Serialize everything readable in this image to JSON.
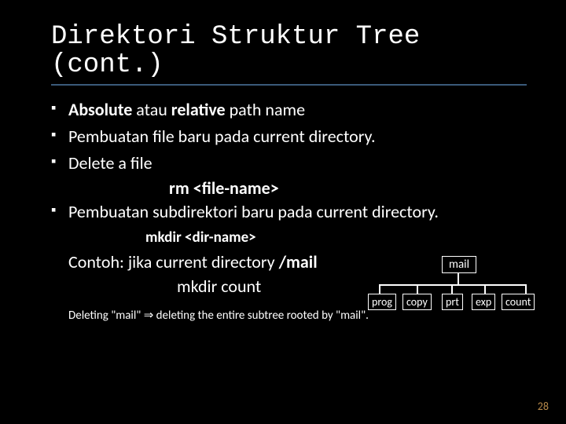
{
  "title": "Direktori Struktur Tree (cont.)",
  "bullets": {
    "b1_pre": "Absolute",
    "b1_mid": " atau ",
    "b1_bold2": "relative",
    "b1_post": " path name",
    "b2": "Pembuatan file baru pada current directory.",
    "b3": "Delete a file",
    "b3_cmd": "rm <file-name>",
    "b4": "Pembuatan subdirektori baru pada current directory.",
    "b4_cmd": "mkdir <dir-name>"
  },
  "example": {
    "line1_pre": "Contoh:  jika current directory   ",
    "line1_bold": "/mail",
    "line2": "mkdir count"
  },
  "tree": {
    "root": "mail",
    "children": [
      "prog",
      "copy",
      "prt",
      "exp",
      "count"
    ]
  },
  "footnote": {
    "pre": "Deleting \"mail\" ",
    "arrow": "⇒",
    "post": " deleting the entire subtree rooted by \"mail\"."
  },
  "page": "28"
}
